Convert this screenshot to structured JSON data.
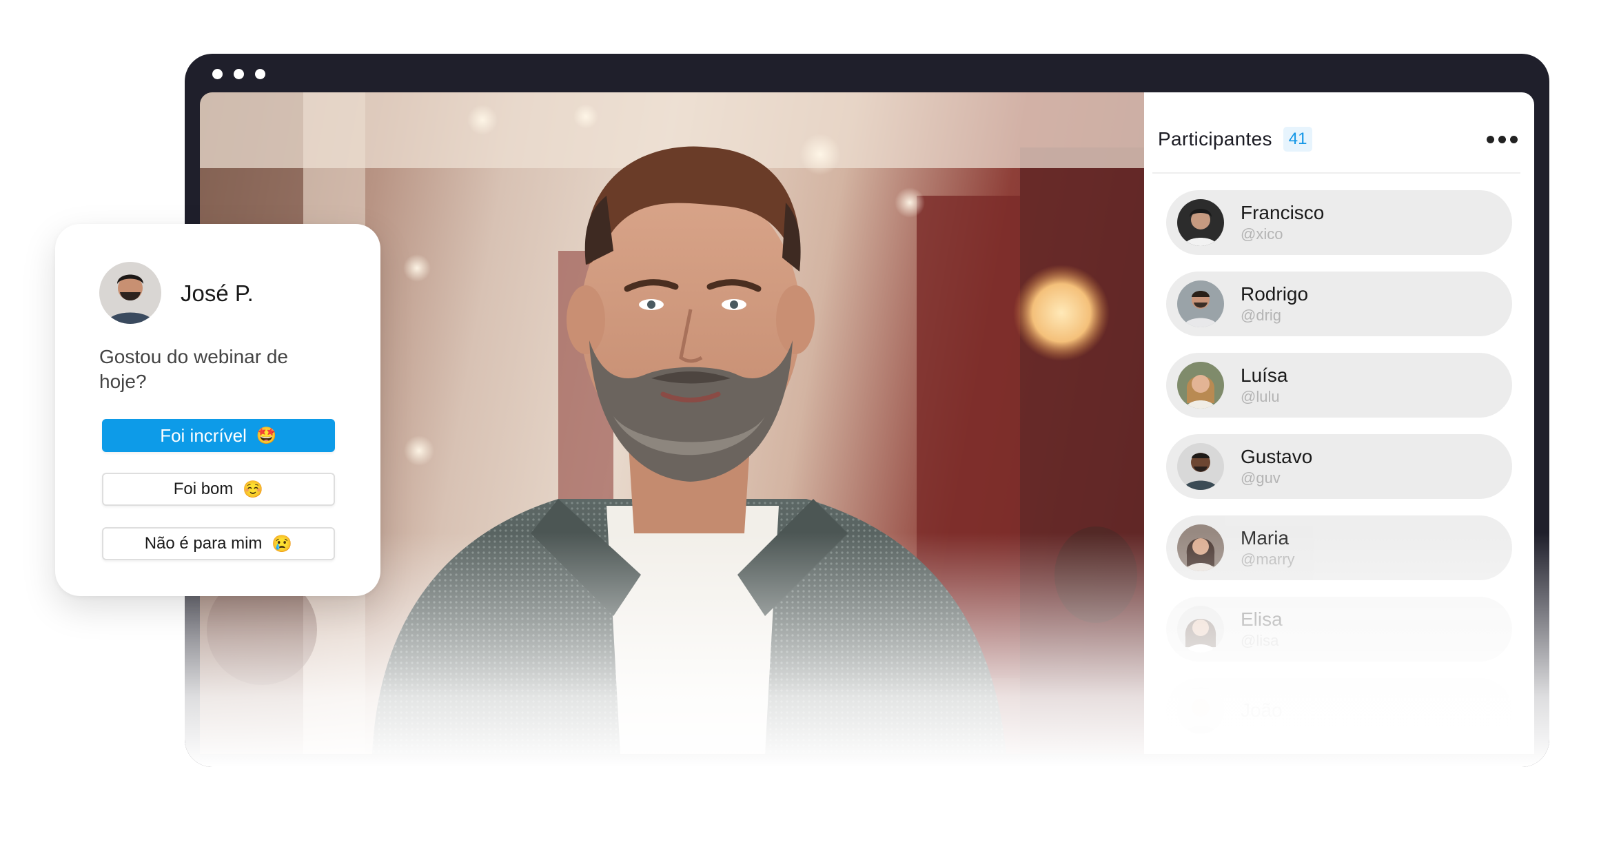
{
  "colors": {
    "frame": "#1f1f2b",
    "accent": "#0d9be8",
    "badge_bg": "#e7f4fd",
    "badge_text": "#1296e6",
    "item_bg": "#ececec",
    "handle_text": "#b4b4b4"
  },
  "window": {
    "controls": [
      "dot",
      "dot",
      "dot"
    ]
  },
  "video": {
    "icon": "presenter-video-feed"
  },
  "participants": {
    "title": "Participantes",
    "count": "41",
    "more_icon": "more-horizontal-icon",
    "items": [
      {
        "name": "Francisco",
        "handle": "@xico",
        "opacity": 1.0
      },
      {
        "name": "Rodrigo",
        "handle": "@drig",
        "opacity": 1.0
      },
      {
        "name": "Luísa",
        "handle": "@lulu",
        "opacity": 1.0
      },
      {
        "name": "Gustavo",
        "handle": "@guv",
        "opacity": 1.0
      },
      {
        "name": "Maria",
        "handle": "@marry",
        "opacity": 0.85
      },
      {
        "name": "Elisa",
        "handle": "@lisa",
        "opacity": 0.45
      },
      {
        "name": "João",
        "handle": "",
        "opacity": 0.15
      }
    ]
  },
  "poll_card": {
    "user_name": "José P.",
    "question": "Gostou do webinar de hoje?",
    "options": [
      {
        "label": "Foi incrível",
        "emoji": "🤩",
        "selected": true
      },
      {
        "label": "Foi bom",
        "emoji": "☺️",
        "selected": false
      },
      {
        "label": "Não é para mim",
        "emoji": "😢",
        "selected": false
      }
    ]
  }
}
